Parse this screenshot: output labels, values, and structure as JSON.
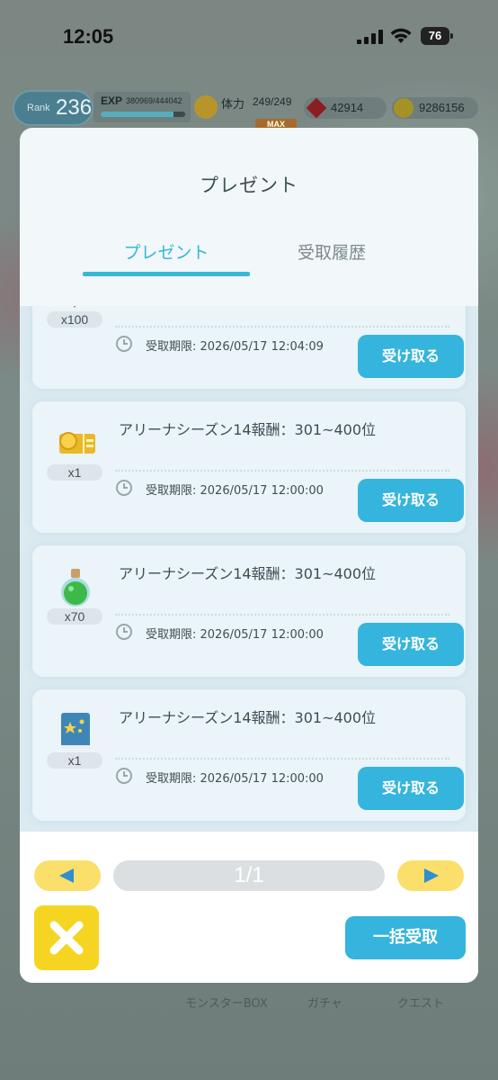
{
  "status_bar": {
    "time": "12:05",
    "battery": "76"
  },
  "hud": {
    "rank_label": "Rank",
    "rank_value": "236",
    "exp_label": "EXP",
    "exp_value": "380969/444042",
    "exp_fraction": 0.858,
    "stamina_label": "体力",
    "stamina_value": "249/249",
    "stamina_max_badge": "MAX",
    "gems": "42914",
    "coins": "9286156"
  },
  "background_nav": {
    "items": [
      "モンスターBOX",
      "ガチャ",
      "クエスト"
    ]
  },
  "modal": {
    "title": "プレゼント",
    "tabs": [
      {
        "label": "プレゼント",
        "active": true
      },
      {
        "label": "受取履歴",
        "active": false
      }
    ],
    "items": [
      {
        "icon": "red-gem-icon",
        "quantity": "x100",
        "title": "",
        "deadline": "受取期限: 2026/05/17 12:04:09",
        "button": "受け取る"
      },
      {
        "icon": "gold-ticket-icon",
        "quantity": "x1",
        "title": "アリーナシーズン14報酬：301~400位",
        "deadline": "受取期限: 2026/05/17 12:00:00",
        "button": "受け取る"
      },
      {
        "icon": "green-potion-icon",
        "quantity": "x70",
        "title": "アリーナシーズン14報酬：301~400位",
        "deadline": "受取期限: 2026/05/17 12:00:00",
        "button": "受け取る"
      },
      {
        "icon": "blue-book-icon",
        "quantity": "x1",
        "title": "アリーナシーズン14報酬：301~400位",
        "deadline": "受取期限: 2026/05/17 12:00:00",
        "button": "受け取る"
      }
    ],
    "pagination": "1/1",
    "bulk_claim": "一括受取"
  },
  "colors": {
    "accent": "#35b4dd",
    "tab_active": "#38b7d8",
    "pager_yellow": "#fadf6a",
    "close_yellow": "#f5d521"
  }
}
